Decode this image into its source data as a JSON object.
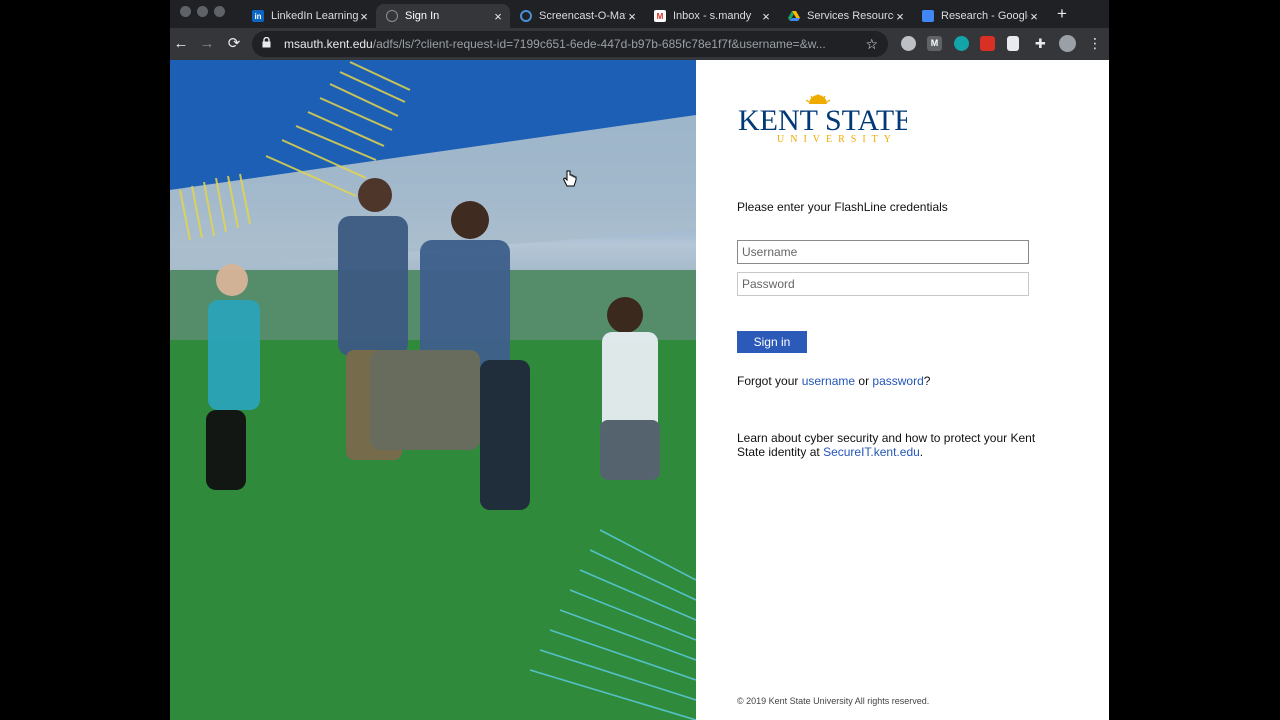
{
  "tabs": [
    {
      "title": "LinkedIn Learning",
      "icon": "linkedin-icon",
      "color": "#0a66c2",
      "glyph": "in"
    },
    {
      "title": "Sign In",
      "icon": "loading-icon",
      "color": "#5f6368",
      "glyph": "",
      "active": true
    },
    {
      "title": "Screencast-O-Matic",
      "icon": "screencast-icon",
      "color": "#4a90d9",
      "glyph": ""
    },
    {
      "title": "Inbox - s.mandy",
      "icon": "gmail-icon",
      "color": "#d93025",
      "glyph": "M"
    },
    {
      "title": "Services Resources",
      "icon": "drive-icon",
      "color": "#1fa463",
      "glyph": ""
    },
    {
      "title": "Research - Google",
      "icon": "docs-icon",
      "color": "#4285f4",
      "glyph": ""
    }
  ],
  "tab_close_glyph": "×",
  "new_tab_glyph": "+",
  "toolbar": {
    "back_glyph": "←",
    "forward_glyph": "→",
    "reload_glyph": "⟳",
    "lock_glyph": "🔒",
    "star_glyph": "☆",
    "url_host": "msauth.kent.edu",
    "url_path": "/adfs/ls/?client-request-id=7199c651-6ede-447d-b97b-685fc78e1f7f&username=&w..."
  },
  "login": {
    "logo_top": "KENT STATE",
    "logo_bottom": "UNIVERSITY",
    "prompt": "Please enter your FlashLine credentials",
    "username_placeholder": "Username",
    "password_placeholder": "Password",
    "signin_label": "Sign in",
    "forgot_prefix": "Forgot your ",
    "forgot_username": "username",
    "forgot_or": " or ",
    "forgot_password": "password",
    "forgot_suffix": "?",
    "learn_text": "Learn about cyber security and how to protect your Kent State identity at ",
    "learn_link": "SecureIT.kent.edu",
    "learn_suffix": ".",
    "copyright": "© 2019 Kent State University All rights reserved."
  },
  "colors": {
    "brand_blue": "#003976",
    "brand_gold": "#efab00",
    "button_blue": "#2b5ab8"
  }
}
